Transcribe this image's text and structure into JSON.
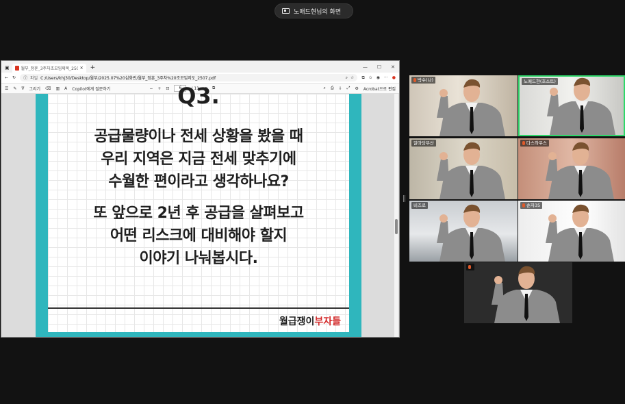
{
  "share_banner": {
    "label": "노매드현님의 화면"
  },
  "browser": {
    "tab_title": "월부_정훈_3주차조모임제목_2507",
    "address_label": "파일",
    "url": "C:/Users/khj30/Desktop/월부/2025.07%20심화반/월부_정훈_3주차%20조모임지도_2507.pdf",
    "pdf_toolbar": {
      "draw_label": "그리기",
      "copilot_label": "Copilot에게 질문하기",
      "current_page": "6",
      "total_pages": "/ 11",
      "acrobat_label": "Acrobat으로 편집"
    }
  },
  "slide": {
    "question_label": "Q3.",
    "lines": [
      "공급물량이나 전세 상황을 봤을 때",
      "우리 지역은 지금 전세 맞추기에",
      "수월한 편이라고 생각하나요?",
      "또 앞으로 2년 후 공급을 살펴보고",
      "어떤 리스크에 대비해야 할지",
      "이야기 나눠봅시다."
    ],
    "brand_black": "월급쟁이",
    "brand_red": "부자들"
  },
  "participants": [
    {
      "name": "박수(나)"
    },
    {
      "name": "노매드현(호스트)"
    },
    {
      "name": "알마당부산"
    },
    {
      "name": "다스하우스"
    },
    {
      "name": "비즈로"
    },
    {
      "name": "순자35"
    },
    {
      "name": ""
    }
  ],
  "colors": {
    "active_speaker": "#2fd76a",
    "slide_frame": "#2fb6bd",
    "brand_red": "#d42a2a"
  }
}
